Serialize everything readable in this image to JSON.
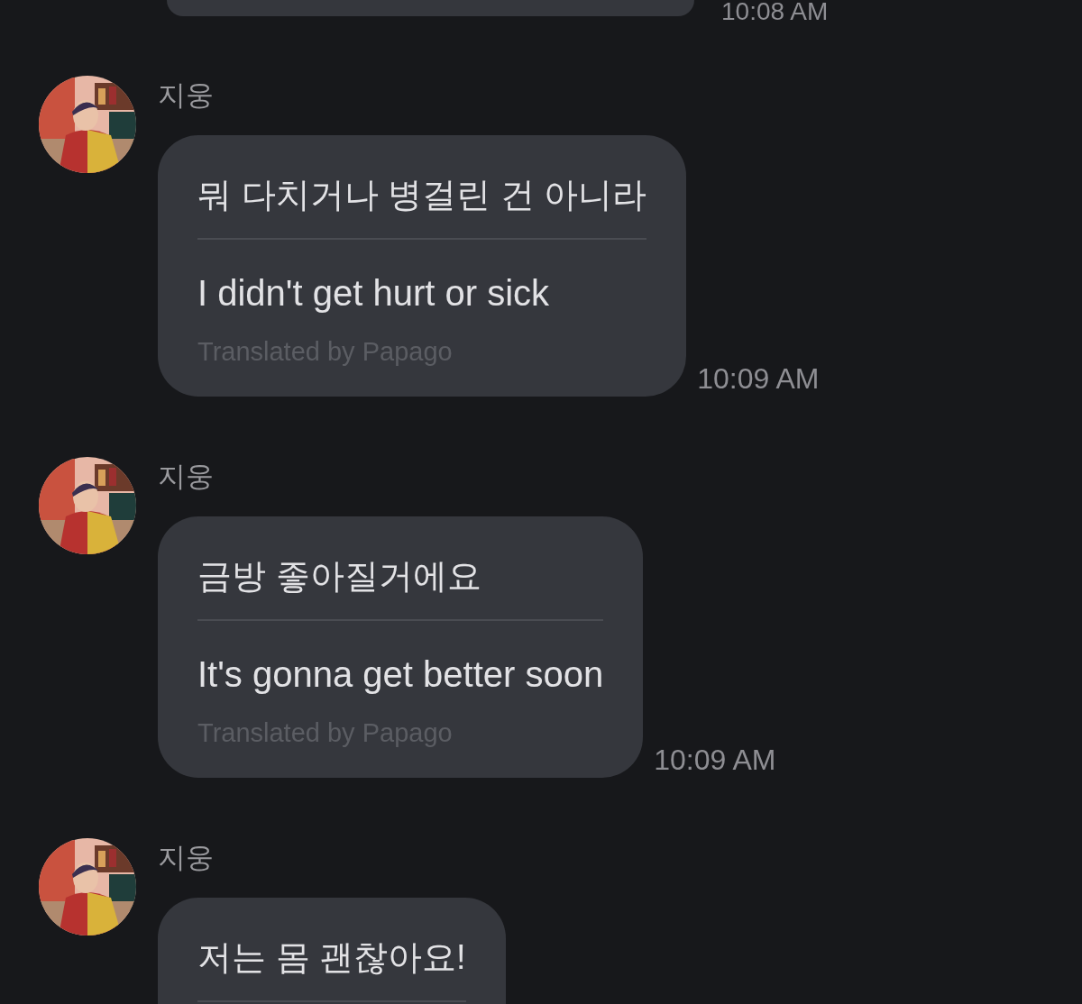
{
  "previous": {
    "timestamp": "10:08 AM"
  },
  "messages": [
    {
      "sender": "지웅",
      "original": "뭐 다치거나 병걸린 건 아니라",
      "translation": "I didn't get hurt or sick",
      "translated_by": "Translated by Papago",
      "timestamp": "10:09 AM"
    },
    {
      "sender": "지웅",
      "original": "금방 좋아질거에요",
      "translation": "It's gonna get better soon",
      "translated_by": "Translated by Papago",
      "timestamp": "10:09 AM"
    },
    {
      "sender": "지웅",
      "original": "저는 몸 괜찮아요!"
    }
  ]
}
